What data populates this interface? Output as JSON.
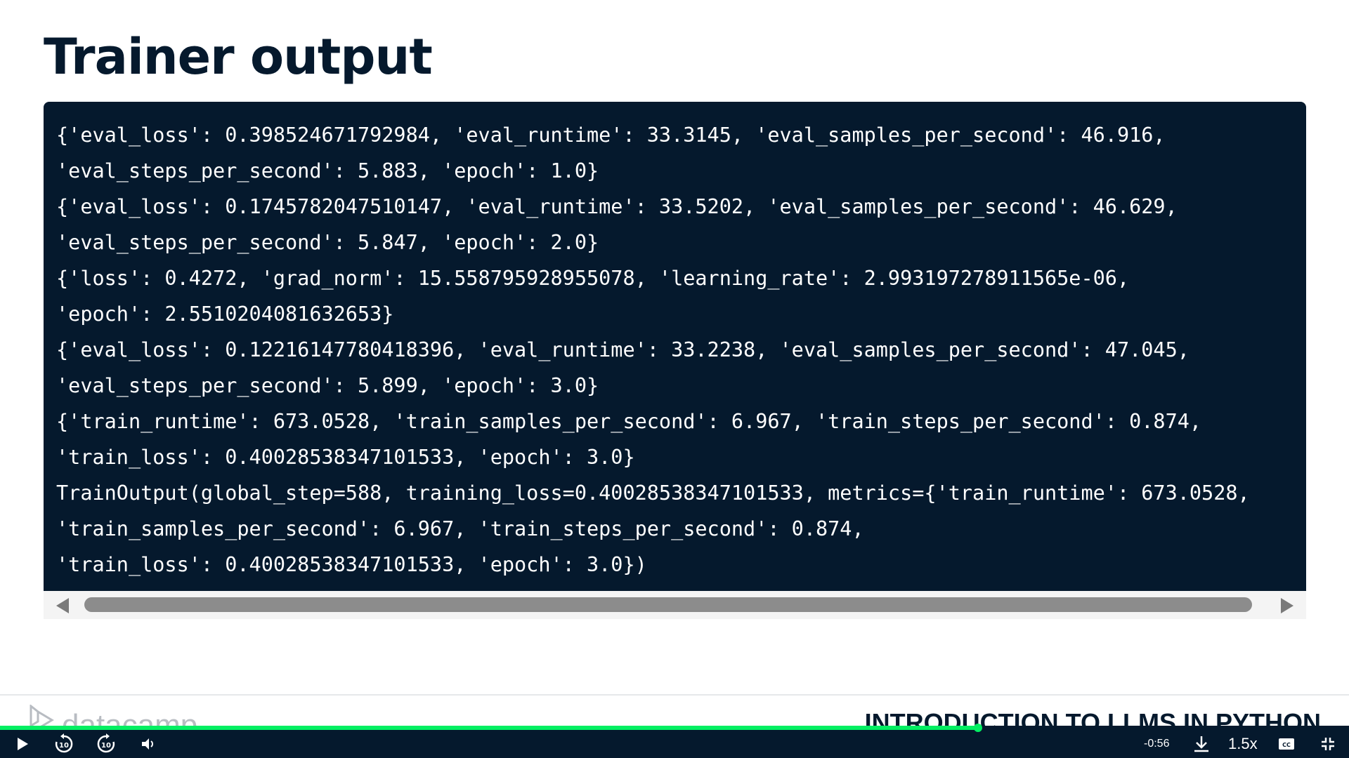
{
  "slide": {
    "title": "Trainer output"
  },
  "code_output": {
    "lines": [
      "{'eval_loss': 0.398524671792984, 'eval_runtime': 33.3145, 'eval_samples_per_second': 46.916,",
      "'eval_steps_per_second': 5.883, 'epoch': 1.0}",
      "{'eval_loss': 0.1745782047510147, 'eval_runtime': 33.5202, 'eval_samples_per_second': 46.629,",
      "'eval_steps_per_second': 5.847, 'epoch': 2.0}",
      "{'loss': 0.4272, 'grad_norm': 15.558795928955078, 'learning_rate': 2.993197278911565e-06,",
      "'epoch': 2.5510204081632653}",
      "{'eval_loss': 0.12216147780418396, 'eval_runtime': 33.2238, 'eval_samples_per_second': 47.045,",
      "'eval_steps_per_second': 5.899, 'epoch': 3.0}",
      "{'train_runtime': 673.0528, 'train_samples_per_second': 6.967, 'train_steps_per_second': 0.874,",
      "'train_loss': 0.40028538347101533, 'epoch': 3.0}",
      "TrainOutput(global_step=588, training_loss=0.40028538347101533, metrics={'train_runtime': 673.0528,",
      "'train_samples_per_second': 6.967, 'train_steps_per_second': 0.874,",
      "'train_loss': 0.40028538347101533, 'epoch': 3.0})"
    ]
  },
  "footer": {
    "brand": "datacamp",
    "course_title": "INTRODUCTION TO LLMS IN PYTHON"
  },
  "player": {
    "time_remaining": "-0:56",
    "speed": "1.5x",
    "progress_fraction": 0.725,
    "icons": {
      "play": "play-icon",
      "rewind": "rewind-10-icon",
      "forward": "forward-10-icon",
      "volume": "volume-icon",
      "download": "download-icon",
      "captions": "captions-icon",
      "fullscreen": "exit-fullscreen-icon"
    },
    "accent_color": "#03ef62"
  }
}
